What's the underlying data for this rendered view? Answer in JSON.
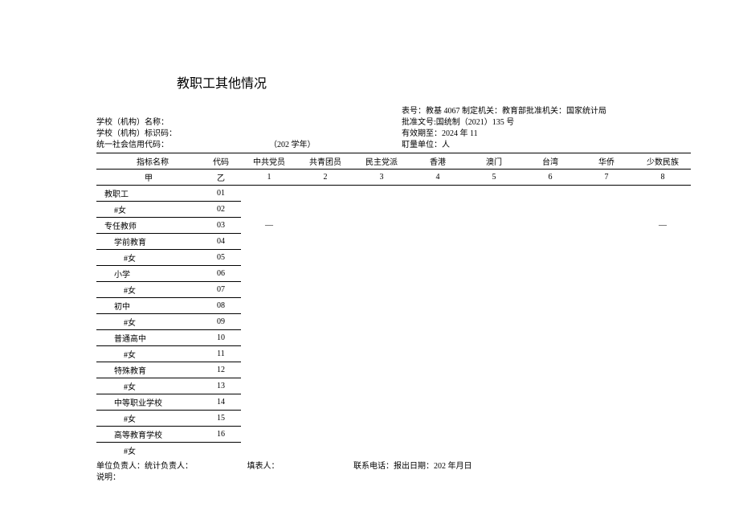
{
  "title": "教职工其他情况",
  "meta": {
    "left": {
      "school_name_label": "学校（机构）名称：",
      "school_id_label": "学校（机构）标识码：",
      "credit_code_label": "统一社会信用代码：",
      "academic_year": "（202 学年）"
    },
    "right": {
      "form_no": "表号：教基 4067 制定机关：教育部批准机关：国家统计局",
      "approval": "批准文号:国统制（2021）135 号",
      "valid": "有效期至：2024 年 11",
      "unit": "耵量单位：人"
    }
  },
  "columns": {
    "label": "指标名称",
    "code": "代码",
    "c1": "中共党员",
    "c2": "共青团员",
    "c3": "民主党派",
    "c4": "香港",
    "c5": "澳门",
    "c6": "台湾",
    "c7": "华侨",
    "c8": "少数民族"
  },
  "subheader": {
    "label": "甲",
    "code": "乙",
    "v1": "1",
    "v2": "2",
    "v3": "3",
    "v4": "4",
    "v5": "5",
    "v6": "6",
    "v7": "7",
    "v8": "8"
  },
  "rows": [
    {
      "label": "教职工",
      "code": "01",
      "indent": 0
    },
    {
      "label": "#女",
      "code": "02",
      "indent": 1
    },
    {
      "label": "专任教师",
      "code": "03",
      "indent": 0,
      "dash1": "—",
      "dash8": "—"
    },
    {
      "label": "学前教育",
      "code": "04",
      "indent": 1
    },
    {
      "label": "#女",
      "code": "05",
      "indent": 2
    },
    {
      "label": "小学",
      "code": "06",
      "indent": 1
    },
    {
      "label": "#女",
      "code": "07",
      "indent": 2
    },
    {
      "label": "初中",
      "code": "08",
      "indent": 1
    },
    {
      "label": "#女",
      "code": "09",
      "indent": 2
    },
    {
      "label": "普通高中",
      "code": "10",
      "indent": 1
    },
    {
      "label": "#女",
      "code": "11",
      "indent": 2
    },
    {
      "label": "特殊教育",
      "code": "12",
      "indent": 1
    },
    {
      "label": "#女",
      "code": "13",
      "indent": 2
    },
    {
      "label": "中等职业学校",
      "code": "14",
      "indent": 1
    },
    {
      "label": "#女",
      "code": "15",
      "indent": 2
    },
    {
      "label": "高等教育学校",
      "code": "16",
      "indent": 1
    },
    {
      "label": "#女",
      "code": "",
      "indent": 2,
      "nobottom": true
    }
  ],
  "footer": {
    "line1_a": "单位负责人：统计负责人：",
    "line1_b": "填表人：",
    "line1_c": "联系电话：报出日期：202 年月日",
    "line2": "说明："
  }
}
